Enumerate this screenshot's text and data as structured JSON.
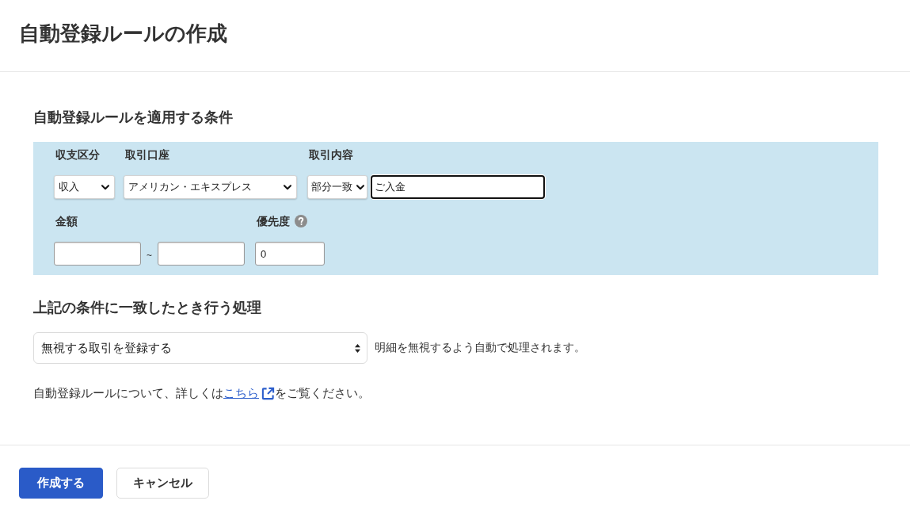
{
  "page": {
    "title": "自動登録ルールの作成"
  },
  "conditions": {
    "heading": "自動登録ルールを適用する条件",
    "income_expense": {
      "label": "収支区分",
      "value": "収入"
    },
    "account": {
      "label": "取引口座",
      "value": "アメリカン・エキスプレス"
    },
    "description": {
      "label": "取引内容",
      "match": "部分一致",
      "value": "ご入金",
      "focused": true
    },
    "amount": {
      "label": "金額",
      "separator": "~"
    },
    "priority": {
      "label": "優先度",
      "value": "0"
    }
  },
  "action": {
    "heading": "上記の条件に一致したとき行う処理",
    "value": "無視する取引を登録する",
    "note": "明細を無視するよう自動で処理されます。"
  },
  "help": {
    "before": "自動登録ルールについて、詳しくは",
    "link": "こちら",
    "after": "をご覧ください。"
  },
  "buttons": [
    {
      "label": "作成する",
      "kind": "primary"
    },
    {
      "label": "キャンセル",
      "kind": "secondary"
    }
  ]
}
